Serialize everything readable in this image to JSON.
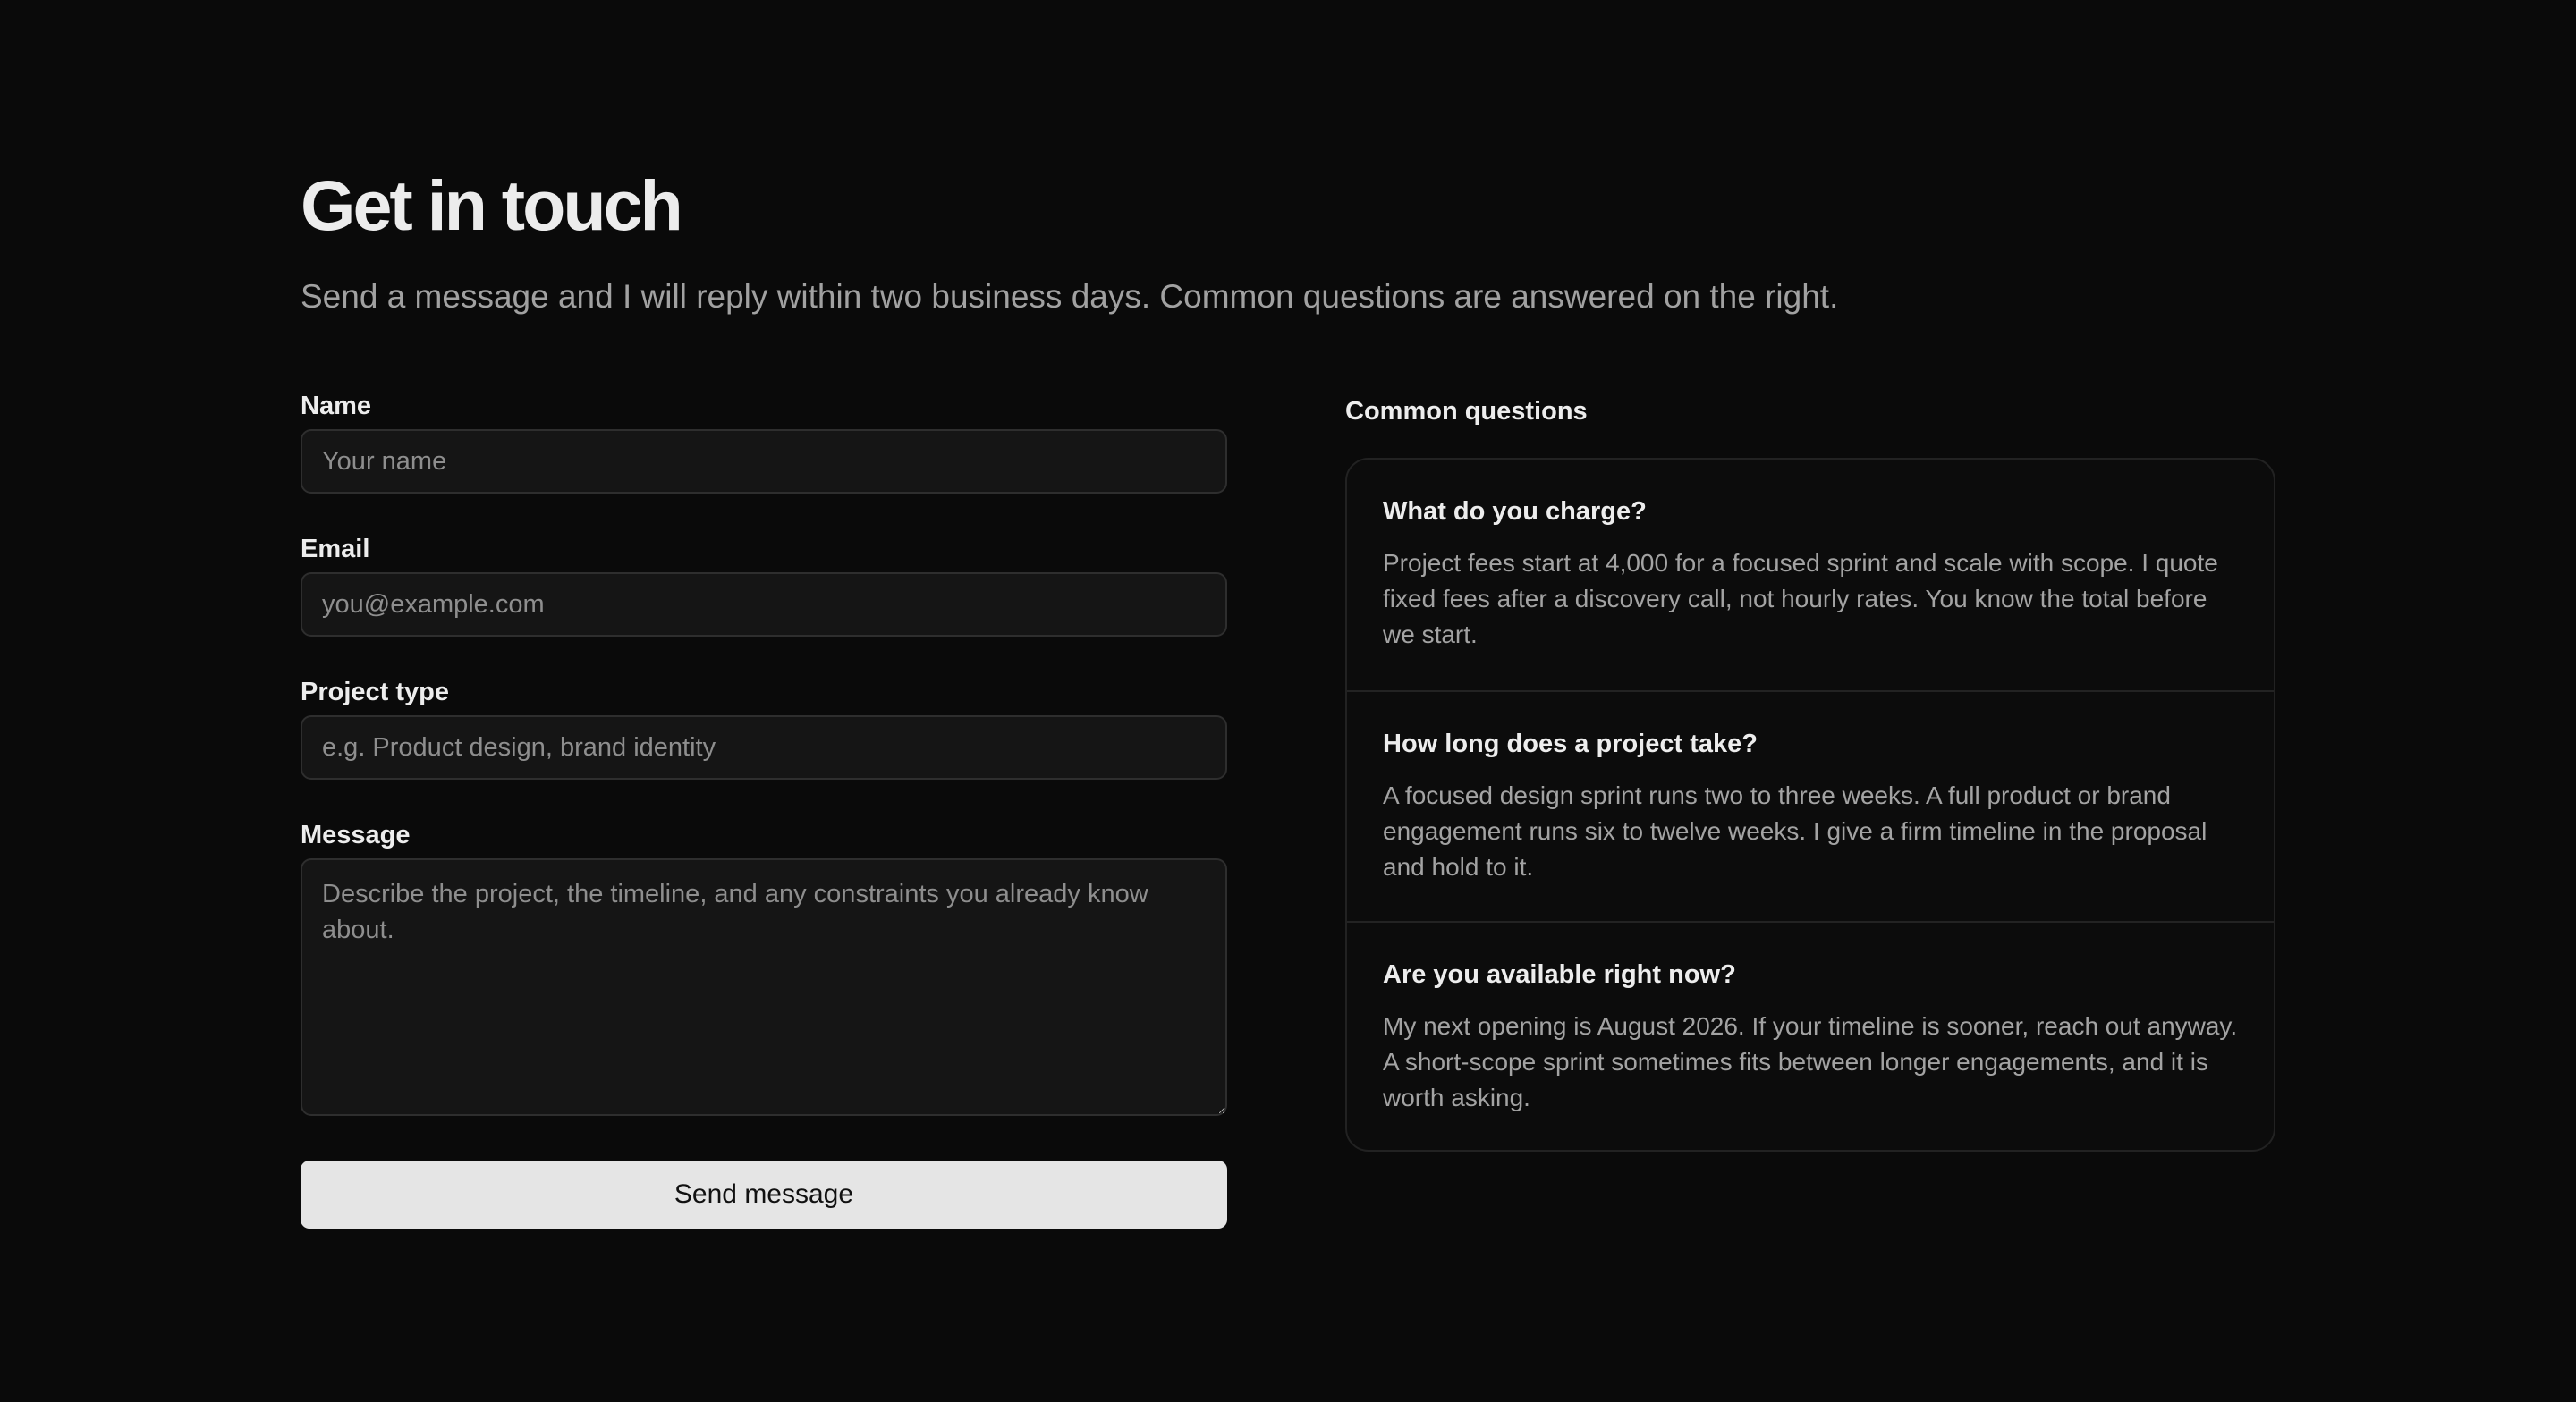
{
  "header": {
    "title": "Get in touch",
    "subtitle": "Send a message and I will reply within two business days. Common questions are answered on the right."
  },
  "form": {
    "name": {
      "label": "Name",
      "placeholder": "Your name",
      "value": ""
    },
    "email": {
      "label": "Email",
      "placeholder": "you@example.com",
      "value": ""
    },
    "project_type": {
      "label": "Project type",
      "placeholder": "e.g. Product design, brand identity",
      "value": ""
    },
    "message": {
      "label": "Message",
      "placeholder": "Describe the project, the timeline, and any constraints you already know about.",
      "value": ""
    },
    "submit_label": "Send message"
  },
  "faq": {
    "heading": "Common questions",
    "items": [
      {
        "question": "What do you charge?",
        "answer": "Project fees start at 4,000 for a focused sprint and scale with scope. I quote fixed fees after a discovery call, not hourly rates. You know the total before we start."
      },
      {
        "question": "How long does a project take?",
        "answer": "A focused design sprint runs two to three weeks. A full product or brand engagement runs six to twelve weeks. I give a firm timeline in the proposal and hold to it."
      },
      {
        "question": "Are you available right now?",
        "answer": "My next opening is August 2026. If your timeline is sooner, reach out anyway. A short-scope sprint sometimes fits between longer engagements, and it is worth asking."
      }
    ]
  },
  "colors": {
    "background": "#0a0a0a",
    "input_background": "#151515",
    "button_background": "#e5e5e5",
    "muted_text": "#a1a1a1"
  }
}
